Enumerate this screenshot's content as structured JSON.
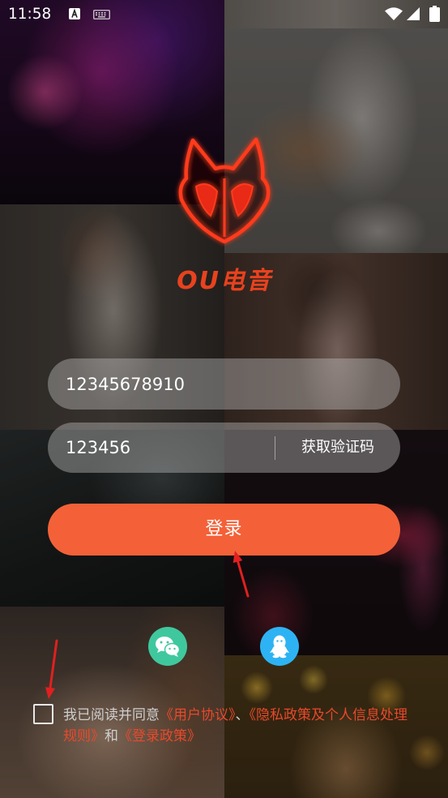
{
  "status_bar": {
    "time": "11:58",
    "left_icons": [
      "a-badge-icon",
      "keyboard-icon"
    ],
    "right_icons": [
      "wifi-icon",
      "signal-icon",
      "battery-icon"
    ]
  },
  "brand": {
    "name": "OU电音",
    "logo_icon": "fox-head-logo-icon",
    "color": "#E8421E"
  },
  "login_form": {
    "phone_input": {
      "value": "12345678910"
    },
    "code_input": {
      "value": "123456"
    },
    "get_code_label": "获取验证码",
    "login_button_label": "登录"
  },
  "social_login": {
    "wechat": {
      "icon": "wechat-icon",
      "color": "#3FC89E"
    },
    "qq": {
      "icon": "qq-icon",
      "color": "#2DB3F3"
    }
  },
  "agreement": {
    "checked": false,
    "prefix": "我已阅读并同意",
    "user_agreement_link": "《用户协议》",
    "separator": "、",
    "privacy_policy_link": "《隐私政策及个人信息处理规则》",
    "conjunction": "和",
    "login_policy_link": "《登录政策》"
  },
  "colors": {
    "accent": "#F46138",
    "link": "#E8492B",
    "logo_neon": "#FF3A1E",
    "annotation_arrow": "#E0201F"
  }
}
